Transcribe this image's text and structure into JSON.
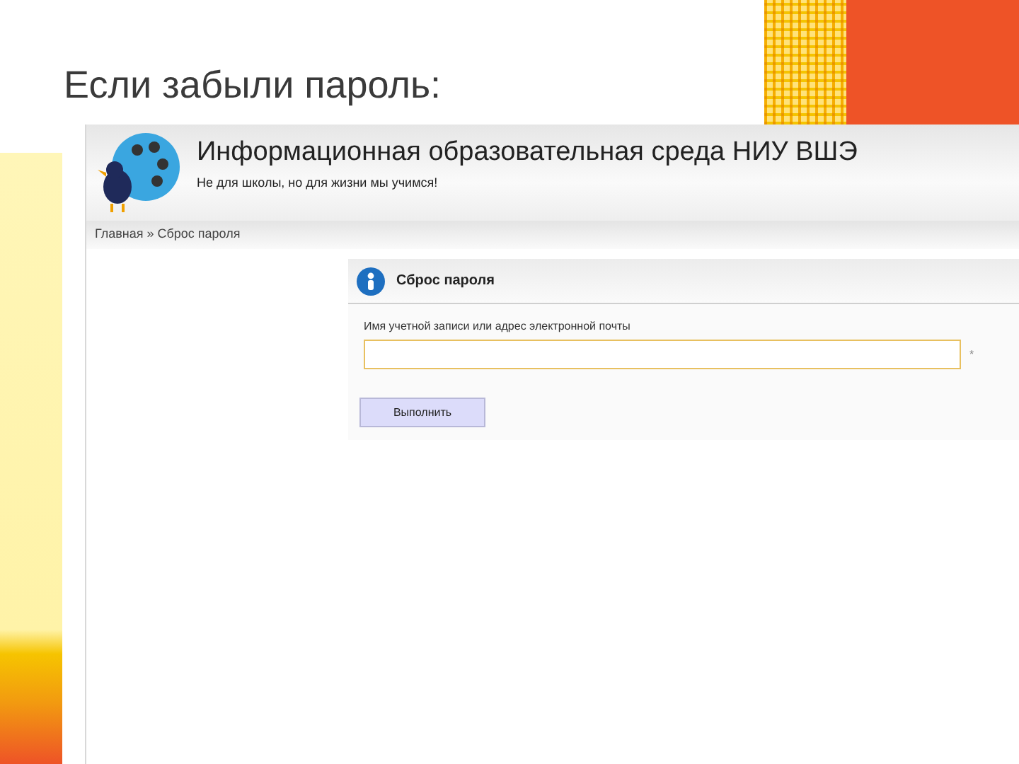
{
  "slide": {
    "title": "Если забыли пароль:"
  },
  "site": {
    "title": "Информационная образовательная среда НИУ ВШЭ",
    "slogan": "Не для школы, но для жизни мы учимся!"
  },
  "breadcrumb": "Главная » Сброс пароля",
  "panel": {
    "title": "Сброс пароля",
    "field_label": "Имя учетной записи или адрес электронной почты",
    "required_mark": "*",
    "button": "Выполнить"
  }
}
